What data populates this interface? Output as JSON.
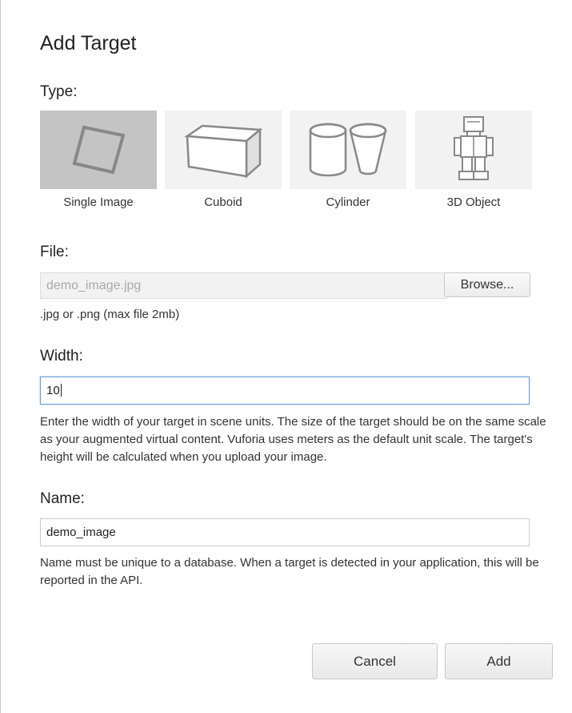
{
  "dialog": {
    "title": "Add Target",
    "type_label": "Type:",
    "types": [
      {
        "label": "Single Image",
        "icon": "single-image-icon",
        "selected": true
      },
      {
        "label": "Cuboid",
        "icon": "cuboid-icon",
        "selected": false
      },
      {
        "label": "Cylinder",
        "icon": "cylinder-icon",
        "selected": false
      },
      {
        "label": "3D Object",
        "icon": "3d-object-icon",
        "selected": false
      }
    ],
    "file_label": "File:",
    "file_value": "demo_image.jpg",
    "browse_label": "Browse...",
    "file_hint": ".jpg or .png (max file 2mb)",
    "width_label": "Width:",
    "width_value": "10",
    "width_hint": "Enter the width of your target in scene units. The size of the target should be on the same scale as your augmented virtual content. Vuforia uses meters as the default unit scale. The target's height will be calculated when you upload your image.",
    "name_label": "Name:",
    "name_value": "demo_image",
    "name_hint": "Name must be unique to a database. When a target is detected in your application, this will be reported in the API.",
    "cancel_label": "Cancel",
    "add_label": "Add"
  },
  "colors": {
    "selected_tile": "#c4c4c4",
    "tile": "#f2f2f2",
    "focus_border": "#6a9fd8"
  }
}
